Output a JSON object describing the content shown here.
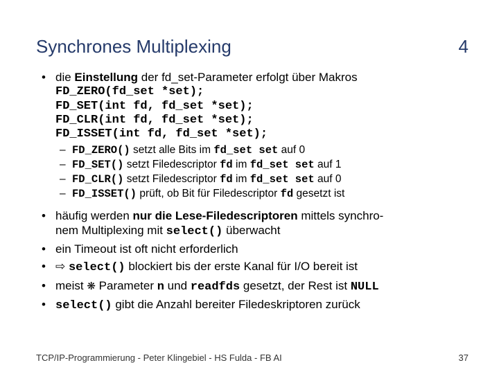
{
  "header": {
    "title": "Synchrones Multiplexing",
    "number": "4"
  },
  "bullets": {
    "b1_pre": "die ",
    "b1_bold": "Einstellung",
    "b1_post": " der fd_set-Parameter erfolgt über Makros",
    "code": "FD_ZERO(fd_set *set);\nFD_SET(int fd, fd_set *set);\nFD_CLR(int fd, fd_set *set);\nFD_ISSET(int fd, fd_set *set);",
    "sub1_m1": "FD_ZERO()",
    "sub1_t1": " setzt alle Bits im ",
    "sub1_m2": "fd_set set",
    "sub1_t2": " auf 0",
    "sub2_m1": "FD_SET()",
    "sub2_t1": " setzt Filedescriptor ",
    "sub2_m2": "fd",
    "sub2_t2": " im ",
    "sub2_m3": "fd_set set",
    "sub2_t3": " auf 1",
    "sub3_m1": "FD_CLR()",
    "sub3_t1": " setzt Filedescriptor ",
    "sub3_m2": "fd",
    "sub3_t2": " im ",
    "sub3_m3": "fd_set set",
    "sub3_t3": " auf 0",
    "sub4_m1": "FD_ISSET()",
    "sub4_t1": " prüft, ob Bit für Filedescriptor ",
    "sub4_m2": "fd",
    "sub4_t2": " gesetzt ist",
    "b2_t1": "häufig werden ",
    "b2_b1": "nur die Lese-Filedescriptoren",
    "b2_t2": " mittels synchro-",
    "b2_t3": "nem Multiplexing mit ",
    "b2_m1": "select()",
    "b2_t4": " überwacht",
    "b3": "ein Timeout ist oft nicht erforderlich",
    "b4_arrow": "⇨",
    "b4_m1": "select()",
    "b4_t1": " blockiert bis der erste Kanal für I/O bereit ist",
    "b5_t1": "meist ",
    "b5_gear": "❋",
    "b5_t2": " Parameter ",
    "b5_m1": "n",
    "b5_t3": " und ",
    "b5_m2": "readfds",
    "b5_t4": " gesetzt, der Rest ist ",
    "b5_m3": "NULL",
    "b6_m1": "select()",
    "b6_t1": " gibt die Anzahl bereiter Filedeskriptoren zurück"
  },
  "footer": {
    "text": "TCP/IP-Programmierung - Peter Klingebiel - HS Fulda - FB AI",
    "page": "37"
  }
}
